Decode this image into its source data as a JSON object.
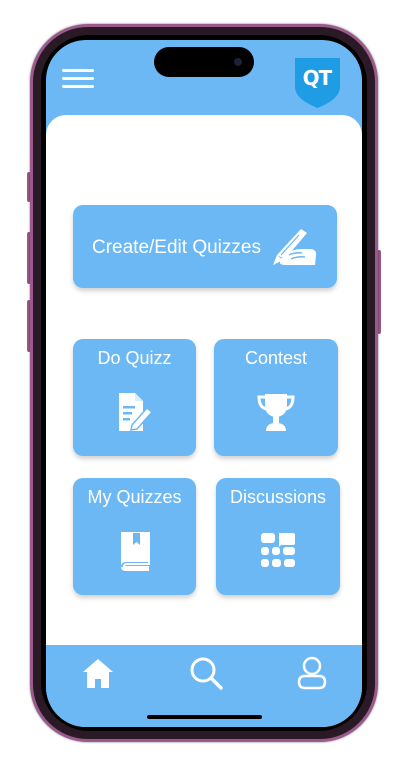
{
  "header": {
    "logo_text": "QT",
    "menu_icon": "hamburger-menu-icon"
  },
  "cards": {
    "create_edit": {
      "label": "Create/Edit Quizzes",
      "icon": "hand-writing-icon"
    },
    "do_quizz": {
      "label": "Do Quizz",
      "icon": "document-edit-icon"
    },
    "contest": {
      "label": "Contest",
      "icon": "trophy-icon"
    },
    "my_quizzes": {
      "label": "My Quizzes",
      "icon": "book-icon"
    },
    "discussions": {
      "label": "Discussions",
      "icon": "discussion-grid-icon"
    }
  },
  "bottom_nav": [
    {
      "icon": "home-icon"
    },
    {
      "icon": "search-icon"
    },
    {
      "icon": "user-icon"
    }
  ],
  "colors": {
    "accent": "#6cb8f4",
    "logo_shield": "#1e9ce4",
    "frame": "#9a5a8c",
    "surface": "#ffffff"
  }
}
